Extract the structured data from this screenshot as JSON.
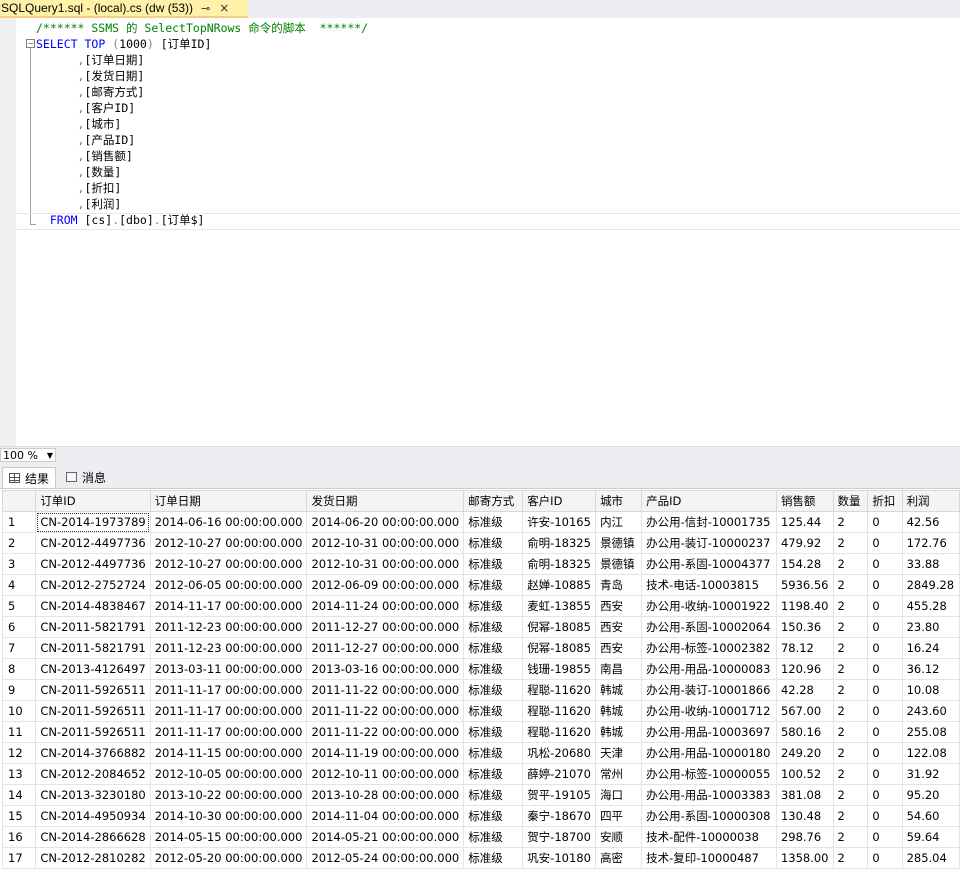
{
  "window": {
    "tab_title": "SQLQuery1.sql - (local).cs (dw (53))",
    "pin_glyph": "⊸",
    "close_glyph": "×"
  },
  "editor": {
    "lines": [
      "/****** SSMS 的 SelectTopNRows 命令的脚本  ******/",
      "SELECT TOP (1000) [订单ID]",
      "      ,[订单日期]",
      "      ,[发货日期]",
      "      ,[邮寄方式]",
      "      ,[客户ID]",
      "      ,[城市]",
      "      ,[产品ID]",
      "      ,[销售额]",
      "      ,[数量]",
      "      ,[折扣]",
      "      ,[利润]",
      "  FROM [cs].[dbo].[订单$]"
    ]
  },
  "status": {
    "zoom": "100 %"
  },
  "results": {
    "tabs": [
      {
        "label": "结果",
        "icon": "grid-icon"
      },
      {
        "label": "消息",
        "icon": "message-icon"
      }
    ],
    "columns": [
      "",
      "订单ID",
      "订单日期",
      "发货日期",
      "邮寄方式",
      "客户ID",
      "城市",
      "产品ID",
      "销售额",
      "数量",
      "折扣",
      "利润"
    ],
    "rows": [
      [
        "1",
        "CN-2014-1973789",
        "2014-06-16 00:00:00.000",
        "2014-06-20 00:00:00.000",
        "标准级",
        "许安-10165",
        "内江",
        "办公用-信封-10001735",
        "125.44",
        "2",
        "0",
        "42.56"
      ],
      [
        "2",
        "CN-2012-4497736",
        "2012-10-27 00:00:00.000",
        "2012-10-31 00:00:00.000",
        "标准级",
        "俞明-18325",
        "景德镇",
        "办公用-装订-10000237",
        "479.92",
        "2",
        "0",
        "172.76"
      ],
      [
        "3",
        "CN-2012-4497736",
        "2012-10-27 00:00:00.000",
        "2012-10-31 00:00:00.000",
        "标准级",
        "俞明-18325",
        "景德镇",
        "办公用-系固-10004377",
        "154.28",
        "2",
        "0",
        "33.88"
      ],
      [
        "4",
        "CN-2012-2752724",
        "2012-06-05 00:00:00.000",
        "2012-06-09 00:00:00.000",
        "标准级",
        "赵婵-10885",
        "青岛",
        "技术-电话-10003815",
        "5936.56",
        "2",
        "0",
        "2849.28"
      ],
      [
        "5",
        "CN-2014-4838467",
        "2014-11-17 00:00:00.000",
        "2014-11-24 00:00:00.000",
        "标准级",
        "麦虹-13855",
        "西安",
        "办公用-收纳-10001922",
        "1198.40",
        "2",
        "0",
        "455.28"
      ],
      [
        "6",
        "CN-2011-5821791",
        "2011-12-23 00:00:00.000",
        "2011-12-27 00:00:00.000",
        "标准级",
        "倪幂-18085",
        "西安",
        "办公用-系固-10002064",
        "150.36",
        "2",
        "0",
        "23.80"
      ],
      [
        "7",
        "CN-2011-5821791",
        "2011-12-23 00:00:00.000",
        "2011-12-27 00:00:00.000",
        "标准级",
        "倪幂-18085",
        "西安",
        "办公用-标签-10002382",
        "78.12",
        "2",
        "0",
        "16.24"
      ],
      [
        "8",
        "CN-2013-4126497",
        "2013-03-11 00:00:00.000",
        "2013-03-16 00:00:00.000",
        "标准级",
        "钱珊-19855",
        "南昌",
        "办公用-用品-10000083",
        "120.96",
        "2",
        "0",
        "36.12"
      ],
      [
        "9",
        "CN-2011-5926511",
        "2011-11-17 00:00:00.000",
        "2011-11-22 00:00:00.000",
        "标准级",
        "程聪-11620",
        "韩城",
        "办公用-装订-10001866",
        "42.28",
        "2",
        "0",
        "10.08"
      ],
      [
        "10",
        "CN-2011-5926511",
        "2011-11-17 00:00:00.000",
        "2011-11-22 00:00:00.000",
        "标准级",
        "程聪-11620",
        "韩城",
        "办公用-收纳-10001712",
        "567.00",
        "2",
        "0",
        "243.60"
      ],
      [
        "11",
        "CN-2011-5926511",
        "2011-11-17 00:00:00.000",
        "2011-11-22 00:00:00.000",
        "标准级",
        "程聪-11620",
        "韩城",
        "办公用-用品-10003697",
        "580.16",
        "2",
        "0",
        "255.08"
      ],
      [
        "12",
        "CN-2014-3766882",
        "2014-11-15 00:00:00.000",
        "2014-11-19 00:00:00.000",
        "标准级",
        "巩松-20680",
        "天津",
        "办公用-用品-10000180",
        "249.20",
        "2",
        "0",
        "122.08"
      ],
      [
        "13",
        "CN-2012-2084652",
        "2012-10-05 00:00:00.000",
        "2012-10-11 00:00:00.000",
        "标准级",
        "薛婷-21070",
        "常州",
        "办公用-标签-10000055",
        "100.52",
        "2",
        "0",
        "31.92"
      ],
      [
        "14",
        "CN-2013-3230180",
        "2013-10-22 00:00:00.000",
        "2013-10-28 00:00:00.000",
        "标准级",
        "贺平-19105",
        "海口",
        "办公用-用品-10003383",
        "381.08",
        "2",
        "0",
        "95.20"
      ],
      [
        "15",
        "CN-2014-4950934",
        "2014-10-30 00:00:00.000",
        "2014-11-04 00:00:00.000",
        "标准级",
        "秦宁-18670",
        "四平",
        "办公用-系固-10000308",
        "130.48",
        "2",
        "0",
        "54.60"
      ],
      [
        "16",
        "CN-2014-2866628",
        "2014-05-15 00:00:00.000",
        "2014-05-21 00:00:00.000",
        "标准级",
        "贺宁-18700",
        "安顺",
        "技术-配件-10000038",
        "298.76",
        "2",
        "0",
        "59.64"
      ],
      [
        "17",
        "CN-2012-2810282",
        "2012-05-20 00:00:00.000",
        "2012-05-24 00:00:00.000",
        "标准级",
        "巩安-10180",
        "高密",
        "技术-复印-10000487",
        "1358.00",
        "2",
        "0",
        "285.04"
      ]
    ]
  }
}
